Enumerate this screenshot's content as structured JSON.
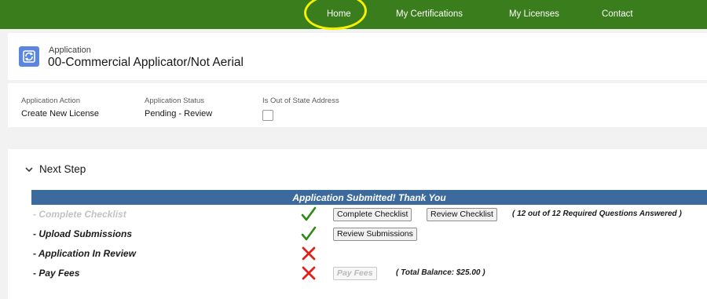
{
  "nav": {
    "items": [
      {
        "label": "Home"
      },
      {
        "label": "My Certifications"
      },
      {
        "label": "My Licenses"
      },
      {
        "label": "Contact"
      }
    ],
    "highlight_color": "#f6f000",
    "bar_color": "#3a7d1c"
  },
  "header": {
    "icon": "application-icon",
    "type": "Application",
    "title": "00-Commercial Applicator/Not Aerial"
  },
  "details": {
    "fields": [
      {
        "label": "Application Action",
        "value": "Create New License"
      },
      {
        "label": "Application Status",
        "value": "Pending - Review"
      },
      {
        "label": "Is Out of State Address",
        "checked": false
      }
    ]
  },
  "next_step": {
    "section_title": "Next Step",
    "banner": "Application Submitted! Thank You",
    "rows": [
      {
        "label": "- Complete Checklist",
        "status": "done",
        "buttons": [
          {
            "label": "Complete Checklist",
            "enabled": true
          },
          {
            "label": "Review Checklist",
            "enabled": true
          }
        ],
        "note": "( 12 out of  12  Required Questions Answered )"
      },
      {
        "label": "- Upload Submissions",
        "status": "done",
        "buttons": [
          {
            "label": "Review Submissions",
            "enabled": true
          }
        ]
      },
      {
        "label": "- Application In Review",
        "status": "pending"
      },
      {
        "label": "- Pay Fees",
        "status": "pending",
        "buttons": [
          {
            "label": "Pay Fees",
            "enabled": false
          }
        ],
        "note": "( Total Balance: $25.00 )"
      }
    ]
  },
  "colors": {
    "check": "#2e8b17",
    "cross": "#e0201a",
    "banner": "#3d6a9c"
  }
}
